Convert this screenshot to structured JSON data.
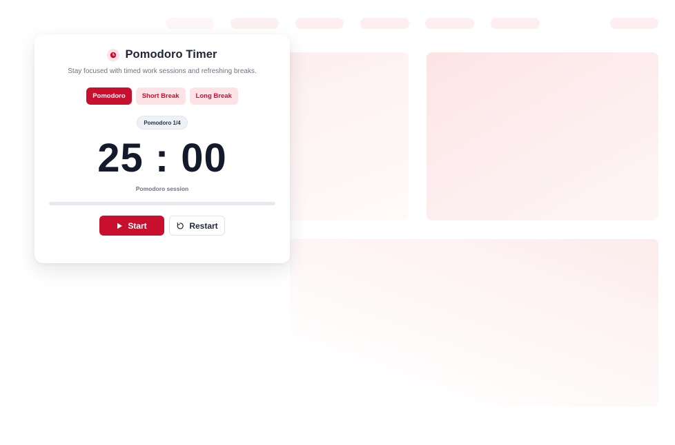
{
  "app": {
    "title": "Pomodoro Timer",
    "subtitle": "Stay focused with timed work sessions and refreshing breaks.",
    "icon": "clock-icon",
    "accent_color": "#c8102e"
  },
  "modes": [
    {
      "label": "Pomodoro",
      "active": true
    },
    {
      "label": "Short Break",
      "active": false
    },
    {
      "label": "Long Break",
      "active": false
    }
  ],
  "counter": {
    "label": "Pomodoro 1/4"
  },
  "timer": {
    "display": "25 : 00",
    "session_label": "Pomodoro session",
    "progress": 0
  },
  "actions": {
    "start_label": "Start",
    "start_icon": "play-icon",
    "restart_label": "Restart",
    "restart_icon": "restart-icon"
  }
}
